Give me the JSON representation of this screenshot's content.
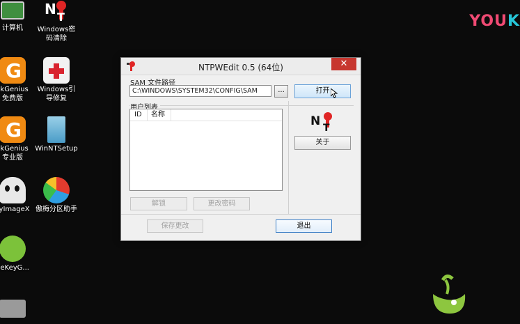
{
  "desktop": {
    "icons": [
      {
        "label": "计算机",
        "icon": "computer-icon"
      },
      {
        "label": "Windows密\n码清除",
        "icon": "ntpwedit-icon"
      },
      {
        "label": "skGenius\n免费版",
        "icon": "diskgenius-icon"
      },
      {
        "label": "Windows引\n导修复",
        "icon": "first-aid-icon"
      },
      {
        "label": "skGenius\n专业版",
        "icon": "diskgenius-icon"
      },
      {
        "label": "WinNTSetup",
        "icon": "winntsetup-icon"
      },
      {
        "label": "syImageX",
        "icon": "ghost-icon"
      },
      {
        "label": "傲梅分区助手",
        "icon": "partition-icon"
      },
      {
        "label": "neKeyG...",
        "icon": "onekey-icon"
      }
    ]
  },
  "watermark": {
    "part1": "YOU",
    "part2": "K"
  },
  "dialog": {
    "title": "NTPWEdit 0.5 (64位)",
    "close_label": "✕",
    "sam_label": "SAM 文件路径",
    "sam_path": "C:\\WINDOWS\\SYSTEM32\\CONFIG\\SAM",
    "browse_label": "...",
    "open_label": "打开",
    "users_label": "用户列表",
    "columns": [
      "ID",
      "名称"
    ],
    "about_label": "关于",
    "unlock_label": "解锁",
    "change_password_label": "更改密码",
    "save_label": "保存更改",
    "exit_label": "退出"
  },
  "colors": {
    "close": "#c7372f",
    "accent": "#3c7fc6"
  }
}
